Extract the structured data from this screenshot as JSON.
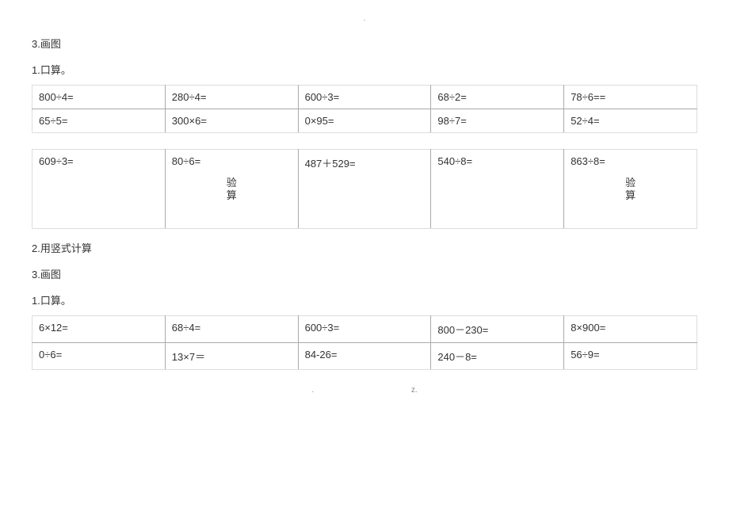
{
  "top_dot": "·",
  "headings": {
    "h3_draw": "3.画图",
    "h1_mental": "1.口算。",
    "h2_vertical": "2.用竖式计算"
  },
  "table1": {
    "rows": [
      [
        "800÷4=",
        "280÷4=",
        "600÷3=",
        "68÷2=",
        "78÷6=="
      ],
      [
        "65÷5=",
        "300×6=",
        "0×95=",
        "98÷7=",
        "52÷4="
      ]
    ]
  },
  "table2": {
    "rows": [
      [
        "609÷3=",
        "80÷6=",
        "487＋529=",
        "540÷8=",
        "863÷8="
      ]
    ],
    "check_label": "验算"
  },
  "table3": {
    "rows": [
      [
        "6×12=",
        "68÷4=",
        "600÷3=",
        "800－230=",
        "8×900="
      ],
      [
        "0÷6=",
        "13×7＝",
        "84-26=",
        "240－8=",
        "56÷9="
      ]
    ]
  },
  "footer": {
    "left": ".",
    "right": "z."
  }
}
